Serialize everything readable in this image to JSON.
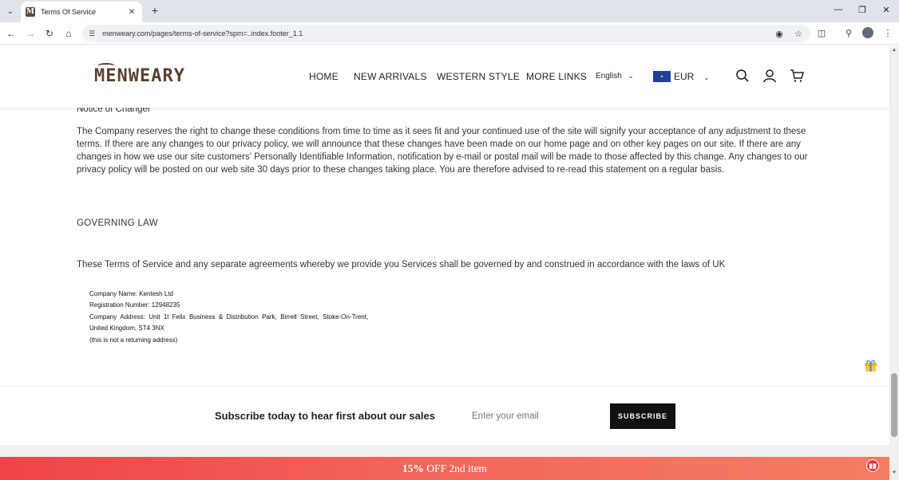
{
  "browser": {
    "tab_title": "Terms Of Service",
    "favicon_letter": "M",
    "url": "menweary.com/pages/terms-of-service?spm=..index.footer_1.1"
  },
  "header": {
    "logo": "MENWEARY",
    "nav": [
      "HOME",
      "NEW ARRIVALS",
      "WESTERN STYLE",
      "MORE LINKS"
    ],
    "language": "English",
    "currency": "EUR"
  },
  "content": {
    "notice_heading": "Notice of Changer",
    "notice_paragraph": "The Company reserves the right to change these conditions from time to time as it sees fit and your continued use of the site will signify your acceptance of any adjustment to these terms. If there are any changes to our privacy policy, we will announce that these changes have been made on our home page and on other key pages on our site. If there are any changes in how we use our site customers' Personally Identifiable Information, notification by e-mail or postal mail will be made to those affected by this change. Any changes to our privacy policy will be posted on our web site 30 days prior to these changes taking place. You are therefore advised to re-read this statement on a regular basis.",
    "law_heading": "GOVERNING LAW",
    "law_text": "These Terms of Service and any separate agreements whereby we provide you Services shall be governed by and construed in accordance with the laws of UK",
    "company_lines": [
      "Company Name: Kentesh Ltd",
      "Registration Number: 12948235",
      "Company  Address:  Unit  1l  Felix  Business  &  Distribution  Park,  Birrell  Street,  Stoke-On-Trent,",
      "United Kingdom, ST4 3NX",
      "(this is not a returning address)"
    ]
  },
  "newsletter": {
    "title": "Subscribe today to hear first about our sales",
    "placeholder": "Enter your email",
    "button": "SUBSCRIBE"
  },
  "promo": {
    "percent": "15%",
    "text": " OFF 2nd item"
  },
  "colors": {
    "promo_start": "#f0434a",
    "promo_end": "#f47d62",
    "logo": "#5a4030",
    "button": "#111111"
  }
}
